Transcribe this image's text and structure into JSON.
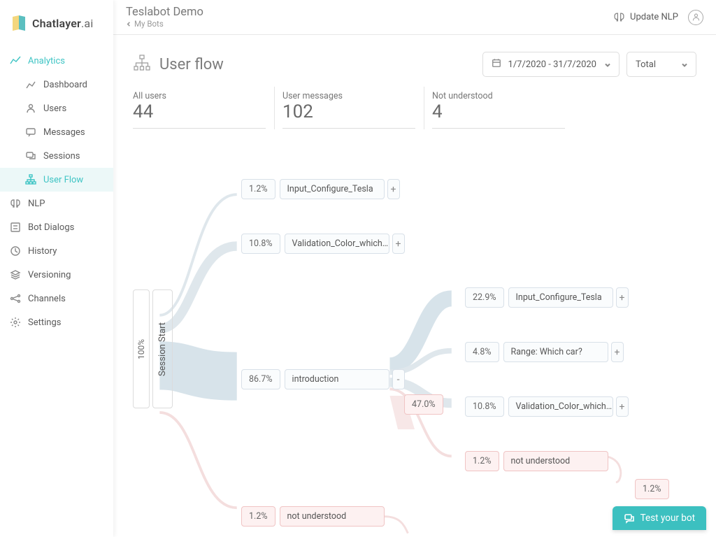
{
  "brand": {
    "name_a": "Chatlayer",
    "name_b": ".ai"
  },
  "header": {
    "bot": "Teslabot Demo",
    "breadcrumb": "My Bots",
    "update": "Update NLP"
  },
  "sidebar": {
    "analytics": "Analytics",
    "dashboard": "Dashboard",
    "users": "Users",
    "messages": "Messages",
    "sessions": "Sessions",
    "userflow": "User Flow",
    "nlp": "NLP",
    "botdialogs": "Bot Dialogs",
    "history": "History",
    "versioning": "Versioning",
    "channels": "Channels",
    "settings": "Settings"
  },
  "page": {
    "title": "User flow"
  },
  "controls": {
    "daterange": "1/7/2020 - 31/7/2020",
    "totals": "Total"
  },
  "stats": {
    "allusers": {
      "label": "All users",
      "value": "44"
    },
    "usermsgs": {
      "label": "User messages",
      "value": "102"
    },
    "notund": {
      "label": "Not understood",
      "value": "4"
    }
  },
  "flow": {
    "root": {
      "pct": "100%",
      "label": "Session Start"
    },
    "lvl1": [
      {
        "pct": "1.2%",
        "label": "Input_Configure_Tesla",
        "expand": "+"
      },
      {
        "pct": "10.8%",
        "label": "Validation_Color_which…",
        "expand": "+"
      },
      {
        "pct": "86.7%",
        "label": "introduction",
        "expand": "-"
      },
      {
        "pct": "1.2%",
        "label": "not understood",
        "red": true
      }
    ],
    "dropoff": {
      "pct": "47.0%"
    },
    "lvl2": [
      {
        "pct": "22.9%",
        "label": "Input_Configure_Tesla",
        "expand": "+"
      },
      {
        "pct": "4.8%",
        "label": "Range: Which car?",
        "expand": "+"
      },
      {
        "pct": "10.8%",
        "label": "Validation_Color_which…",
        "expand": "+"
      },
      {
        "pct": "1.2%",
        "label": "not understood",
        "red": true
      }
    ],
    "tail": {
      "pct": "1.2%"
    }
  },
  "testbot": "Test your bot"
}
